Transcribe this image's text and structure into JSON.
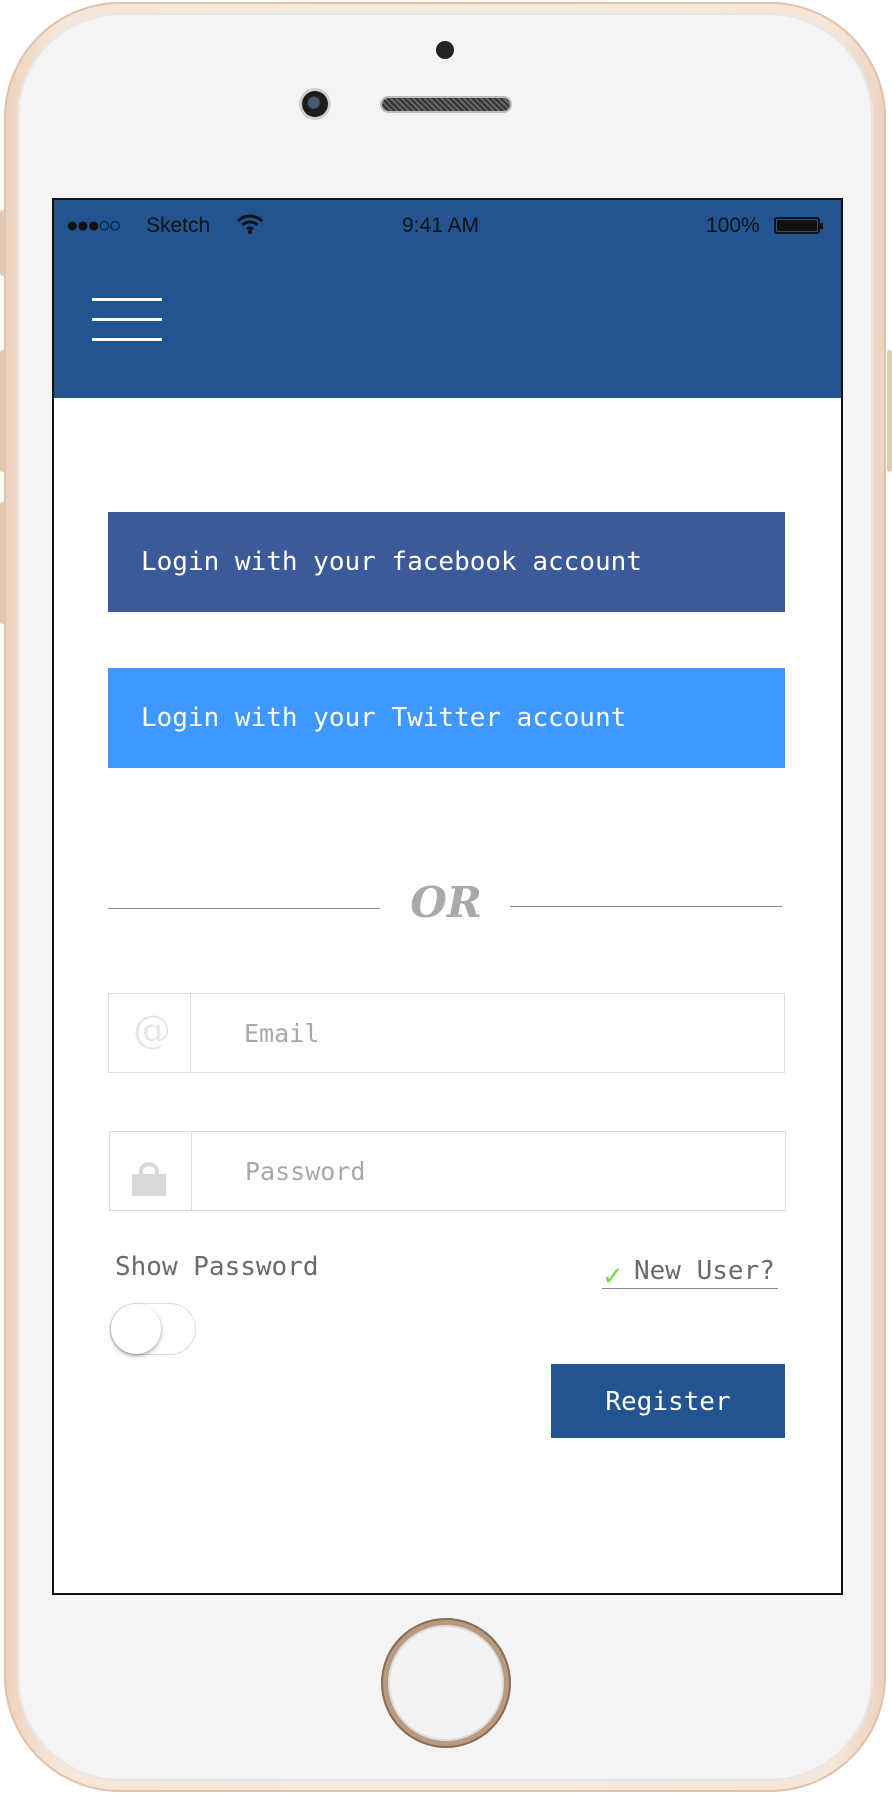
{
  "status_bar": {
    "signal": "●●●○○",
    "carrier": "Sketch",
    "time": "9:41 AM",
    "battery": "100%"
  },
  "social": {
    "facebook_label": "Login with your facebook account",
    "twitter_label": "Login with your Twitter account"
  },
  "divider": {
    "text": "OR"
  },
  "form": {
    "email_placeholder": "Email",
    "password_placeholder": "Password",
    "show_password_label": "Show Password",
    "show_password_on": false,
    "new_user_label": "New User?",
    "register_label": "Register"
  },
  "colors": {
    "header": "#215491",
    "facebook": "#3c5a9a",
    "twitter": "#3e98ff",
    "register": "#215491",
    "check": "#7cd63d"
  },
  "icons": [
    "signal-dots-icon",
    "wifi-icon",
    "battery-icon",
    "hamburger-menu-icon",
    "at-icon",
    "lock-icon",
    "check-icon"
  ]
}
